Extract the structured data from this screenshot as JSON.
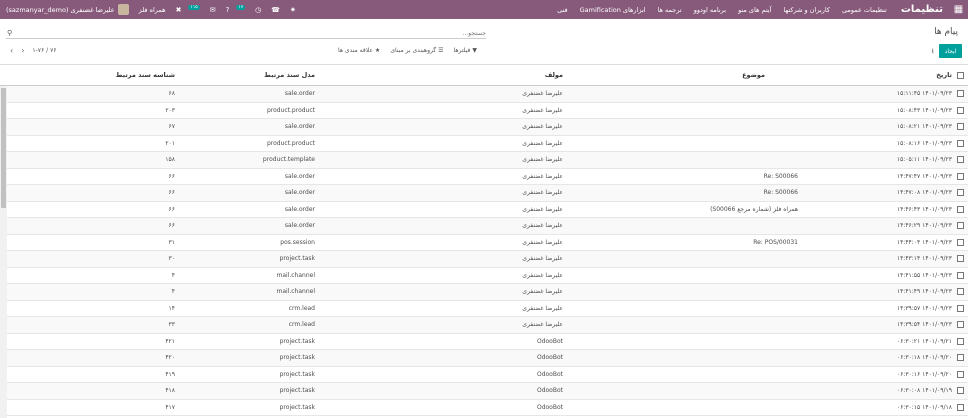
{
  "navbar": {
    "brand": "تنظیمات",
    "menu": [
      "تنظیمات عمومی",
      "کاربران و شرکتها",
      "آیتم های منو",
      "برنامه اودوو",
      "ترجمه ها",
      "ابزارهای Gamification",
      "فنی"
    ],
    "badge_chat": "۱۱۵",
    "badge_activity": "۱۷",
    "company": "همراه فلز",
    "user": "علیرضا غضنفری (sazmanyar_demo)"
  },
  "control_panel": {
    "title": "پیام ها",
    "search_placeholder": "جستجو...",
    "create_label": "ایجاد",
    "filters_label": "فیلترها",
    "group_by_label": "گروهبندی بر مبنای",
    "favorites_label": "علاقه مندی ها",
    "pager": "۱-۷۶ / ۷۶"
  },
  "table": {
    "headers": {
      "date": "تاریخ",
      "subject": "موضوع",
      "author": "مولف",
      "model": "مدل سند مرتبط",
      "res_id": "شناسه سند مرتبط"
    },
    "rows": [
      {
        "date": "۱۴۰۱/۰۹/۲۳ ۱۵:۱۱:۴۵",
        "subject": "",
        "author": "علیرضا غضنفری",
        "model": "sale.order",
        "res_id": "۶۸"
      },
      {
        "date": "۱۴۰۱/۰۹/۲۳ ۱۵:۰۸:۴۳",
        "subject": "",
        "author": "علیرضا غضنفری",
        "model": "product.product",
        "res_id": "۲۰۳"
      },
      {
        "date": "۱۴۰۱/۰۹/۲۳ ۱۵:۰۸:۲۱",
        "subject": "",
        "author": "علیرضا غضنفری",
        "model": "sale.order",
        "res_id": "۶۷"
      },
      {
        "date": "۱۴۰۱/۰۹/۲۳ ۱۵:۰۸:۱۶",
        "subject": "",
        "author": "علیرضا غضنفری",
        "model": "product.product",
        "res_id": "۲۰۱"
      },
      {
        "date": "۱۴۰۱/۰۹/۲۳ ۱۵:۰۵:۱۱",
        "subject": "",
        "author": "علیرضا غضنفری",
        "model": "product.template",
        "res_id": "۱۵۸"
      },
      {
        "date": "۱۴۰۱/۰۹/۲۳ ۱۴:۴۷:۴۷",
        "subject": "Re: S00066",
        "author": "علیرضا غضنفری",
        "model": "sale.order",
        "res_id": "۶۶"
      },
      {
        "date": "۱۴۰۱/۰۹/۲۳ ۱۴:۴۷:۰۸",
        "subject": "Re: S00066",
        "author": "علیرضا غضنفری",
        "model": "sale.order",
        "res_id": "۶۶"
      },
      {
        "date": "۱۴۰۱/۰۹/۲۳ ۱۴:۴۶:۴۳",
        "subject": "همراه فلز (شماره مرجع S00066)",
        "author": "علیرضا غضنفری",
        "model": "sale.order",
        "res_id": "۶۶"
      },
      {
        "date": "۱۴۰۱/۰۹/۲۳ ۱۴:۴۶:۲۹",
        "subject": "",
        "author": "علیرضا غضنفری",
        "model": "sale.order",
        "res_id": "۶۶"
      },
      {
        "date": "۱۴۰۱/۰۹/۲۳ ۱۴:۴۴:۰۴",
        "subject": "Re: POS/00031",
        "author": "علیرضا غضنفری",
        "model": "pos.session",
        "res_id": "۳۱"
      },
      {
        "date": "۱۴۰۱/۰۹/۲۳ ۱۴:۴۳:۱۴",
        "subject": "",
        "author": "علیرضا غضنفری",
        "model": "project.task",
        "res_id": "۳۰"
      },
      {
        "date": "۱۴۰۱/۰۹/۲۳ ۱۴:۴۱:۵۵",
        "subject": "",
        "author": "علیرضا غضنفری",
        "model": "mail.channel",
        "res_id": "۴"
      },
      {
        "date": "۱۴۰۱/۰۹/۲۳ ۱۴:۴۱:۴۹",
        "subject": "",
        "author": "علیرضا غضنفری",
        "model": "mail.channel",
        "res_id": "۴"
      },
      {
        "date": "۱۴۰۱/۰۹/۲۳ ۱۴:۳۹:۵۷",
        "subject": "",
        "author": "علیرضا غضنفری",
        "model": "crm.lead",
        "res_id": "۱۴"
      },
      {
        "date": "۱۴۰۱/۰۹/۲۳ ۱۴:۳۹:۵۴",
        "subject": "",
        "author": "علیرضا غضنفری",
        "model": "crm.lead",
        "res_id": "۳۳"
      },
      {
        "date": "۱۴۰۱/۰۹/۲۱ ۰۶:۳۰:۲۱",
        "subject": "",
        "author": "OdooBot",
        "model": "project.task",
        "res_id": "۴۲۱"
      },
      {
        "date": "۱۴۰۱/۰۹/۲۰ ۰۶:۳۰:۱۸",
        "subject": "",
        "author": "OdooBot",
        "model": "project.task",
        "res_id": "۴۲۰"
      },
      {
        "date": "۱۴۰۱/۰۹/۲۰ ۰۶:۳۰:۱۶",
        "subject": "",
        "author": "OdooBot",
        "model": "project.task",
        "res_id": "۴۱۹"
      },
      {
        "date": "۱۴۰۱/۰۹/۱۹ ۰۶:۳۰:۰۸",
        "subject": "",
        "author": "OdooBot",
        "model": "project.task",
        "res_id": "۴۱۸"
      },
      {
        "date": "۱۴۰۱/۰۹/۱۸ ۰۶:۳۰:۱۵",
        "subject": "",
        "author": "OdooBot",
        "model": "project.task",
        "res_id": "۴۱۷"
      }
    ]
  }
}
